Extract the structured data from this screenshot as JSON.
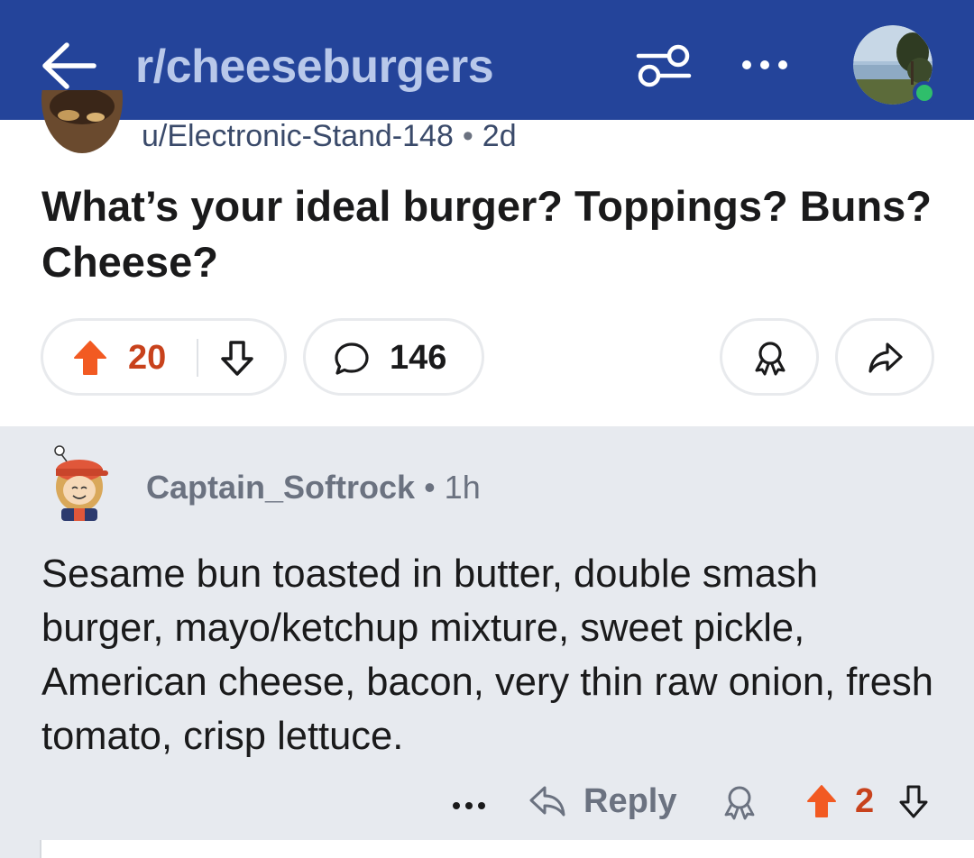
{
  "header": {
    "subreddit": "r/cheeseburgers",
    "back_icon": "arrow-left-icon",
    "filter_icon": "sliders-icon",
    "more_icon": "ellipsis-icon",
    "colors": {
      "bar": "#24449a",
      "title": "#b8c8ea"
    }
  },
  "post": {
    "author": "u/Electronic-Stand-148",
    "age": "2d",
    "separator": "•",
    "title": "What’s your ideal burger? Toppings? Buns? Cheese?",
    "score": "20",
    "comment_count": "146",
    "colors": {
      "upvoted": "#f25a22",
      "score": "#c8421c"
    }
  },
  "comment": {
    "author": "Captain_Softrock",
    "age": "1h",
    "separator": "•",
    "body": "Sesame bun toasted in butter, double smash burger, mayo/ketchup mixture, sweet pickle, American cheese, bacon, very thin raw onion, fresh tomato, crisp lettuce.",
    "actions": {
      "reply_label": "Reply",
      "score": "2"
    },
    "colors": {
      "background": "#e7eaef"
    }
  }
}
